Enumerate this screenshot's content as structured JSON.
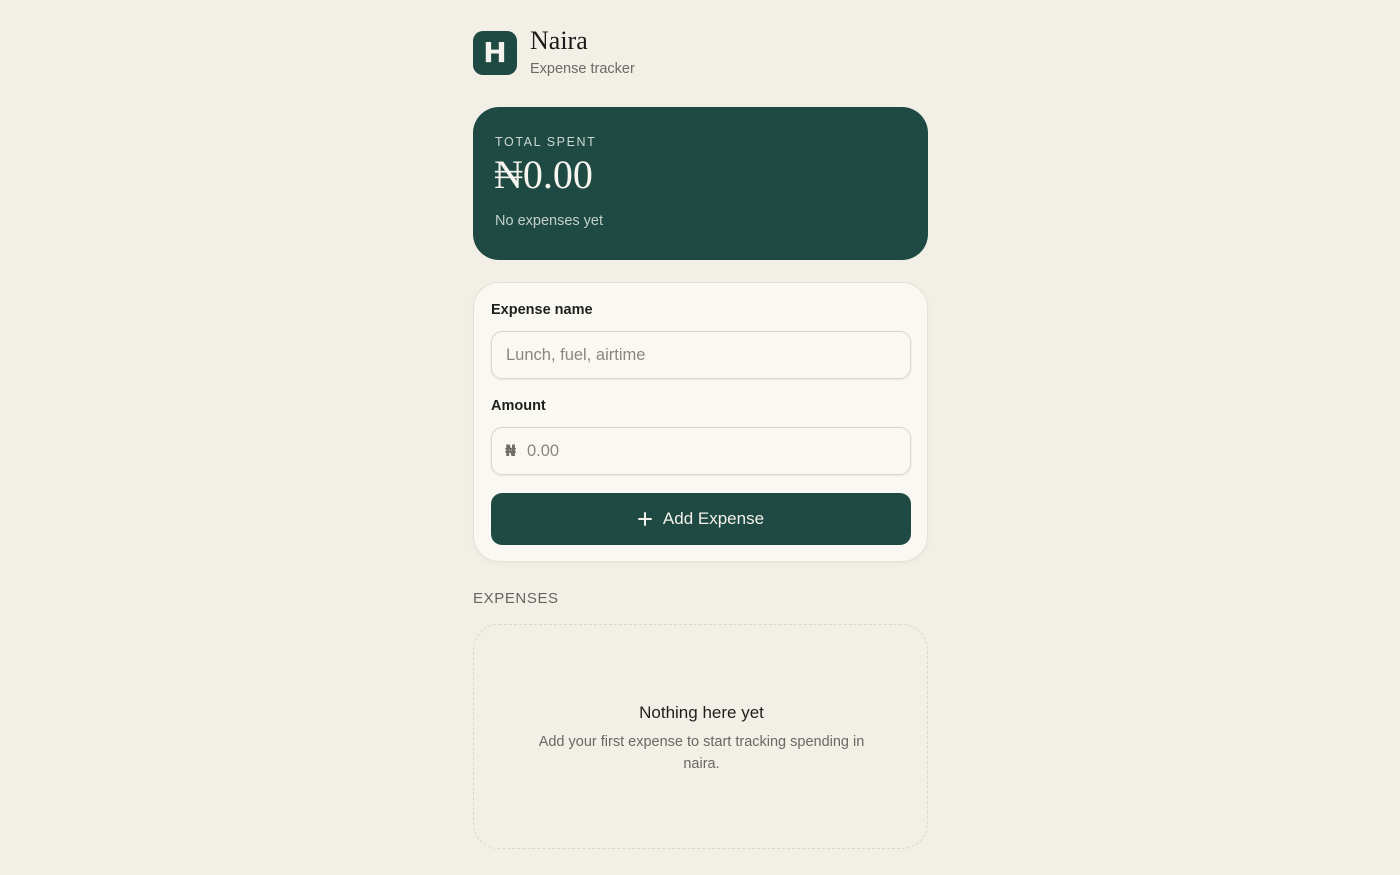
{
  "header": {
    "logo_letter": "H",
    "app_name": "Naira",
    "subtitle": "Expense tracker"
  },
  "summary": {
    "label": "TOTAL SPENT",
    "total": "₦0.00",
    "status": "No expenses yet"
  },
  "form": {
    "name_label": "Expense name",
    "name_placeholder": "Lunch, fuel, airtime",
    "name_value": "",
    "amount_label": "Amount",
    "currency_symbol": "₦",
    "amount_placeholder": "0.00",
    "amount_value": "",
    "add_button_label": "Add Expense",
    "add_button_icon": "plus-icon"
  },
  "expenses": {
    "section_title": "EXPENSES",
    "items": [],
    "empty_title": "Nothing here yet",
    "empty_description": "Add your first expense to start tracking spending in naira."
  },
  "colors": {
    "background": "#f2efe7",
    "accent": "#1f4a43",
    "card": "#faf8f3"
  }
}
